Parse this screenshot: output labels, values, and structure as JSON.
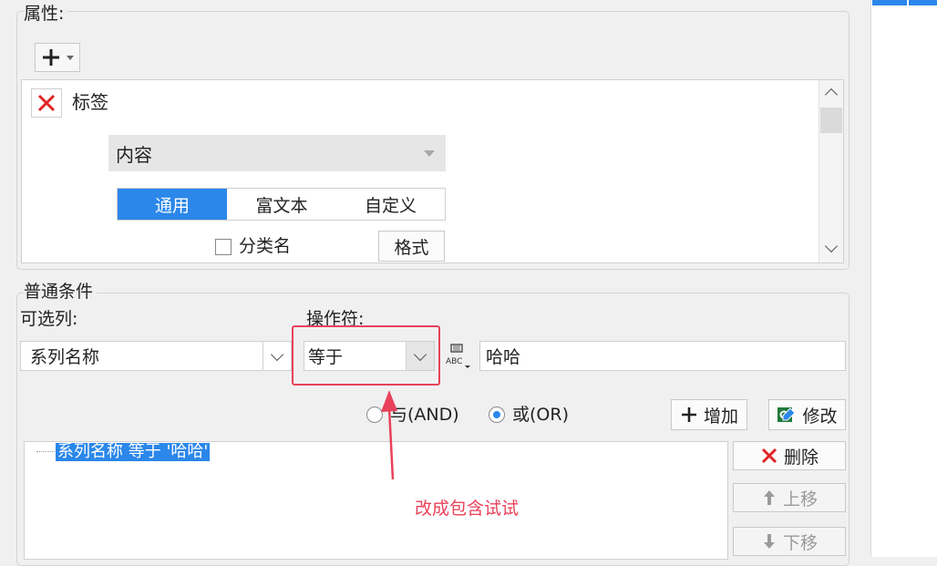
{
  "properties": {
    "title": "属性:",
    "add_icon": "plus-icon",
    "label_item": "标签",
    "content_select": "内容",
    "tabs": [
      "通用",
      "富文本",
      "自定义"
    ],
    "category_checkbox": "分类名",
    "format_button": "格式"
  },
  "condition": {
    "title": "普通条件",
    "optional_column_label": "可选列:",
    "operator_label": "操作符:",
    "column_value": "系列名称",
    "operator_value": "等于",
    "value_input": "哈哈",
    "radio_and": "与(AND)",
    "radio_or": "或(OR)",
    "radio_selected": "or",
    "add_button": "增加",
    "modify_button": "修改",
    "delete_button": "删除",
    "move_up_button": "上移",
    "move_down_button": "下移",
    "tree_item": "系列名称 等于 '哈哈'"
  },
  "annotation": {
    "text": "改成包含试试",
    "color": "#e8425a"
  },
  "colors": {
    "accent": "#2b87e9",
    "delete_red": "#e02424"
  }
}
